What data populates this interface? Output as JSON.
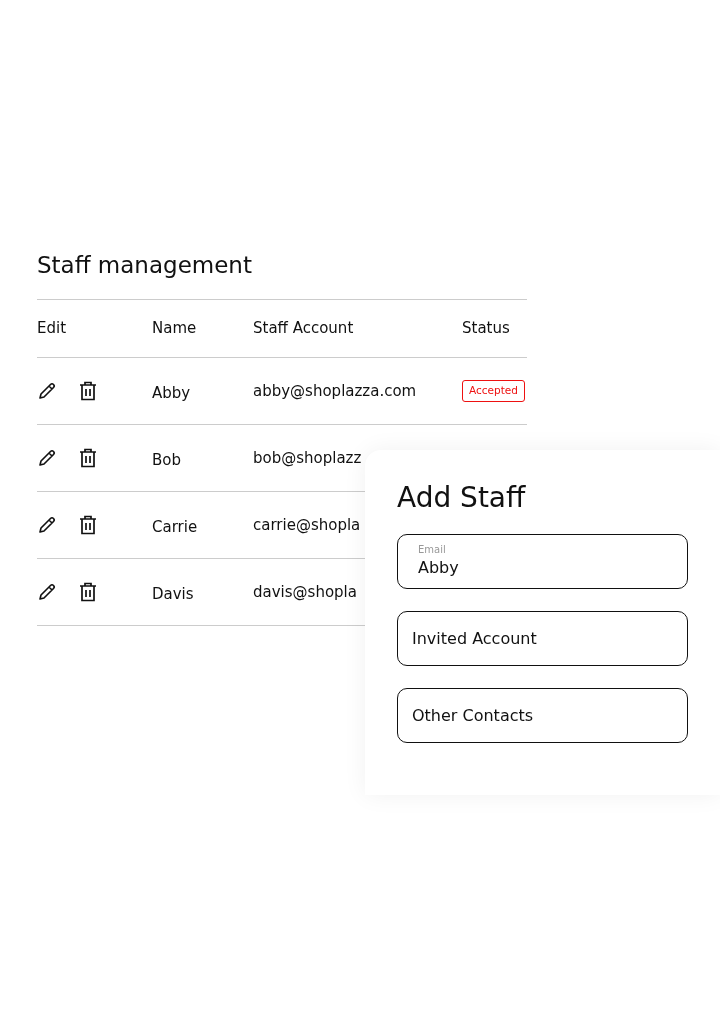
{
  "title": "Staff management",
  "table": {
    "columns": [
      "Edit",
      "Name",
      "Staff Account",
      "Status"
    ],
    "rows": [
      {
        "name": "Abby",
        "account": "abby@shoplazza.com",
        "status": "Accepted"
      },
      {
        "name": "Bob",
        "account": "bob@shoplazz"
      },
      {
        "name": "Carrie",
        "account": "carrie@shopla"
      },
      {
        "name": "Davis",
        "account": "davis@shopla"
      }
    ]
  },
  "add_staff": {
    "title": "Add Staff",
    "fields": [
      {
        "label": "Email",
        "value": "Abby"
      },
      {
        "placeholder": "Invited Account"
      },
      {
        "placeholder": "Other Contacts"
      }
    ]
  }
}
